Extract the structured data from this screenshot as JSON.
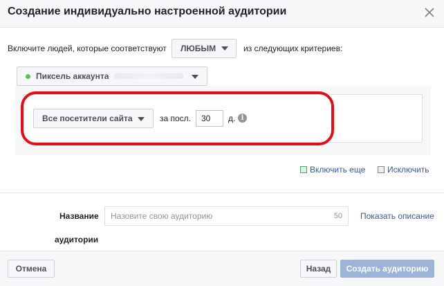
{
  "dialog": {
    "title": "Создание индивидуально настроенной аудитории"
  },
  "criteria": {
    "prefix": "Включите людей, которые соответствуют",
    "match_value": "ЛЮБЫМ",
    "suffix": "из следующих критериев:"
  },
  "source": {
    "label": "Пиксель аккаунта",
    "status_color": "#66bc5c"
  },
  "rule": {
    "event_value": "Все посетители сайта",
    "period_label": "за посл.",
    "days_value": "30",
    "days_unit": "д."
  },
  "actions": {
    "include_more": "Включить еще",
    "exclude": "Исключить"
  },
  "name_field": {
    "label_line1": "Название",
    "label_line2": "аудитории",
    "placeholder": "Назовите свою аудиторию",
    "char_limit": "50",
    "show_description": "Показать описание"
  },
  "footer": {
    "cancel": "Отмена",
    "back": "Назад",
    "create": "Создать аудиторию"
  },
  "colors": {
    "link": "#365899",
    "highlight": "#e0101b",
    "primary_disabled": "#9cb4d8"
  }
}
